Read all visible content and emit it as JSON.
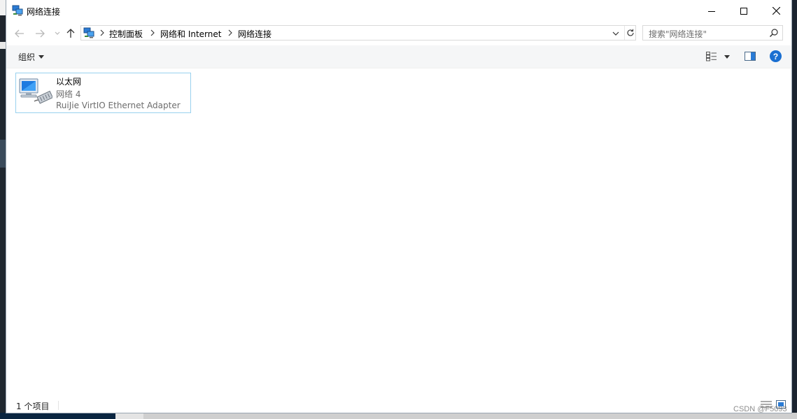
{
  "window": {
    "title": "网络连接"
  },
  "breadcrumb": {
    "items": [
      "控制面板",
      "网络和 Internet",
      "网络连接"
    ]
  },
  "search": {
    "placeholder": "搜索\"网络连接\""
  },
  "toolbar": {
    "organize_label": "组织",
    "help_label": "?"
  },
  "connections": [
    {
      "name": "以太网",
      "network": "网络 4",
      "adapter": "RuiJie VirtIO Ethernet Adapter"
    }
  ],
  "status": {
    "item_count": "1 个项目"
  },
  "watermark": "CSDN @F5093",
  "icons": {
    "title": "network-connections-icon",
    "back": "back-arrow-icon",
    "forward": "forward-arrow-icon",
    "recent": "chevron-down-icon",
    "up": "up-arrow-icon",
    "refresh": "refresh-icon",
    "search": "search-icon",
    "view": "change-view-icon",
    "preview": "preview-pane-icon",
    "help": "help-icon",
    "ethernet": "ethernet-adapter-icon"
  },
  "colors": {
    "selection_border": "#99d1ee",
    "help_blue": "#1a6fd1",
    "command_bar": "#f5f6f7"
  }
}
